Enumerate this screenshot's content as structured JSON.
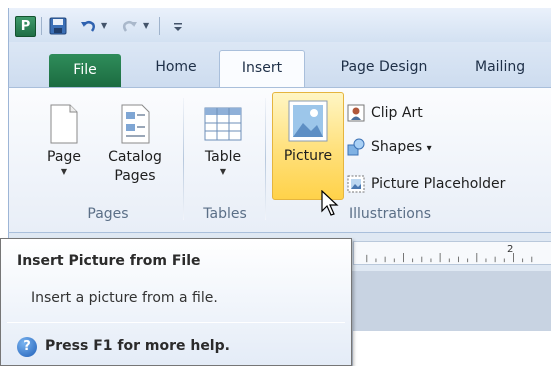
{
  "app": {
    "logo_letter": "P",
    "accent_green": "#1f7a4a"
  },
  "qat": {
    "icons": [
      "publisher-logo-icon",
      "save-icon",
      "undo-icon",
      "redo-icon",
      "customize-qat-icon"
    ]
  },
  "tabs": [
    {
      "id": "file",
      "label": "File"
    },
    {
      "id": "home",
      "label": "Home"
    },
    {
      "id": "insert",
      "label": "Insert",
      "active": true
    },
    {
      "id": "page-design",
      "label": "Page Design"
    },
    {
      "id": "mailings",
      "label": "Mailing"
    }
  ],
  "ribbon": {
    "pages_group": {
      "label": "Pages",
      "page_button": "Page",
      "catalog_button_line1": "Catalog",
      "catalog_button_line2": "Pages"
    },
    "tables_group": {
      "label": "Tables",
      "table_button": "Table"
    },
    "illustrations_group": {
      "label": "Illustrations",
      "picture_button": "Picture",
      "clipart_button": "Clip Art",
      "shapes_button": "Shapes",
      "shapes_arrow": "▾",
      "placeholder_button": "Picture Placeholder"
    }
  },
  "ruler": {
    "visible_number": "2"
  },
  "tooltip": {
    "title": "Insert Picture from File",
    "description": "Insert a picture from a file.",
    "help_glyph": "?",
    "help_text": "Press F1 for more help."
  }
}
